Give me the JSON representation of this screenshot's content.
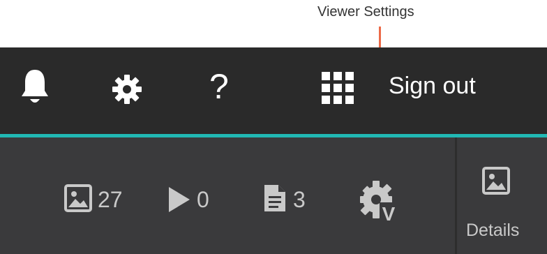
{
  "annotation": {
    "label": "Viewer Settings",
    "color": "#ec6a47"
  },
  "header": {
    "icons": [
      "bell-icon",
      "gear-icon",
      "help-icon",
      "apps-grid-icon"
    ],
    "signout_label": "Sign out",
    "help_glyph": "?"
  },
  "toolbar": {
    "images": {
      "icon": "image-icon",
      "count": "27"
    },
    "videos": {
      "icon": "play-icon",
      "count": "0"
    },
    "documents": {
      "icon": "document-icon",
      "count": "3"
    },
    "viewer_settings": {
      "icon": "gear-v-icon",
      "badge": "V"
    }
  },
  "details": {
    "icon": "image-icon",
    "label": "Details"
  },
  "colors": {
    "header_bg": "#2a2a2a",
    "accent_teal": "#21b8b4",
    "toolbar_bg": "#3a3a3c",
    "icon_gray": "#c9c9c9"
  }
}
